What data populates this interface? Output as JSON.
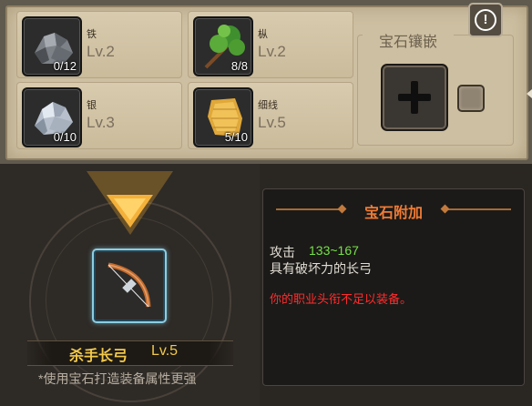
{
  "materials": [
    {
      "name": "铁",
      "level": "Lv.2",
      "qty": "0/12",
      "icon": "iron-ore-icon"
    },
    {
      "name": "枞",
      "level": "Lv.2",
      "qty": "8/8",
      "icon": "fir-branch-icon"
    },
    {
      "name": "银",
      "level": "Lv.3",
      "qty": "0/10",
      "icon": "silver-ore-icon"
    },
    {
      "name": "细线",
      "level": "Lv.5",
      "qty": "5/10",
      "icon": "fine-thread-icon"
    }
  ],
  "gem_socket": {
    "title": "宝石镶嵌"
  },
  "equipment": {
    "name": "杀手长弓",
    "level": "Lv.5",
    "icon": "longbow-icon"
  },
  "hint": "*使用宝石打造装备属性更强",
  "gem_bonus": {
    "title": "宝石附加",
    "attack_label": "攻击",
    "attack_value": "133~167",
    "description": "具有破坏力的长弓",
    "warning": "你的职业头衔不足以装备。"
  },
  "colors": {
    "accent": "#f07b35",
    "attack": "#76e04a",
    "warning": "#ff2d2d",
    "equip_name": "#f2c94c"
  }
}
